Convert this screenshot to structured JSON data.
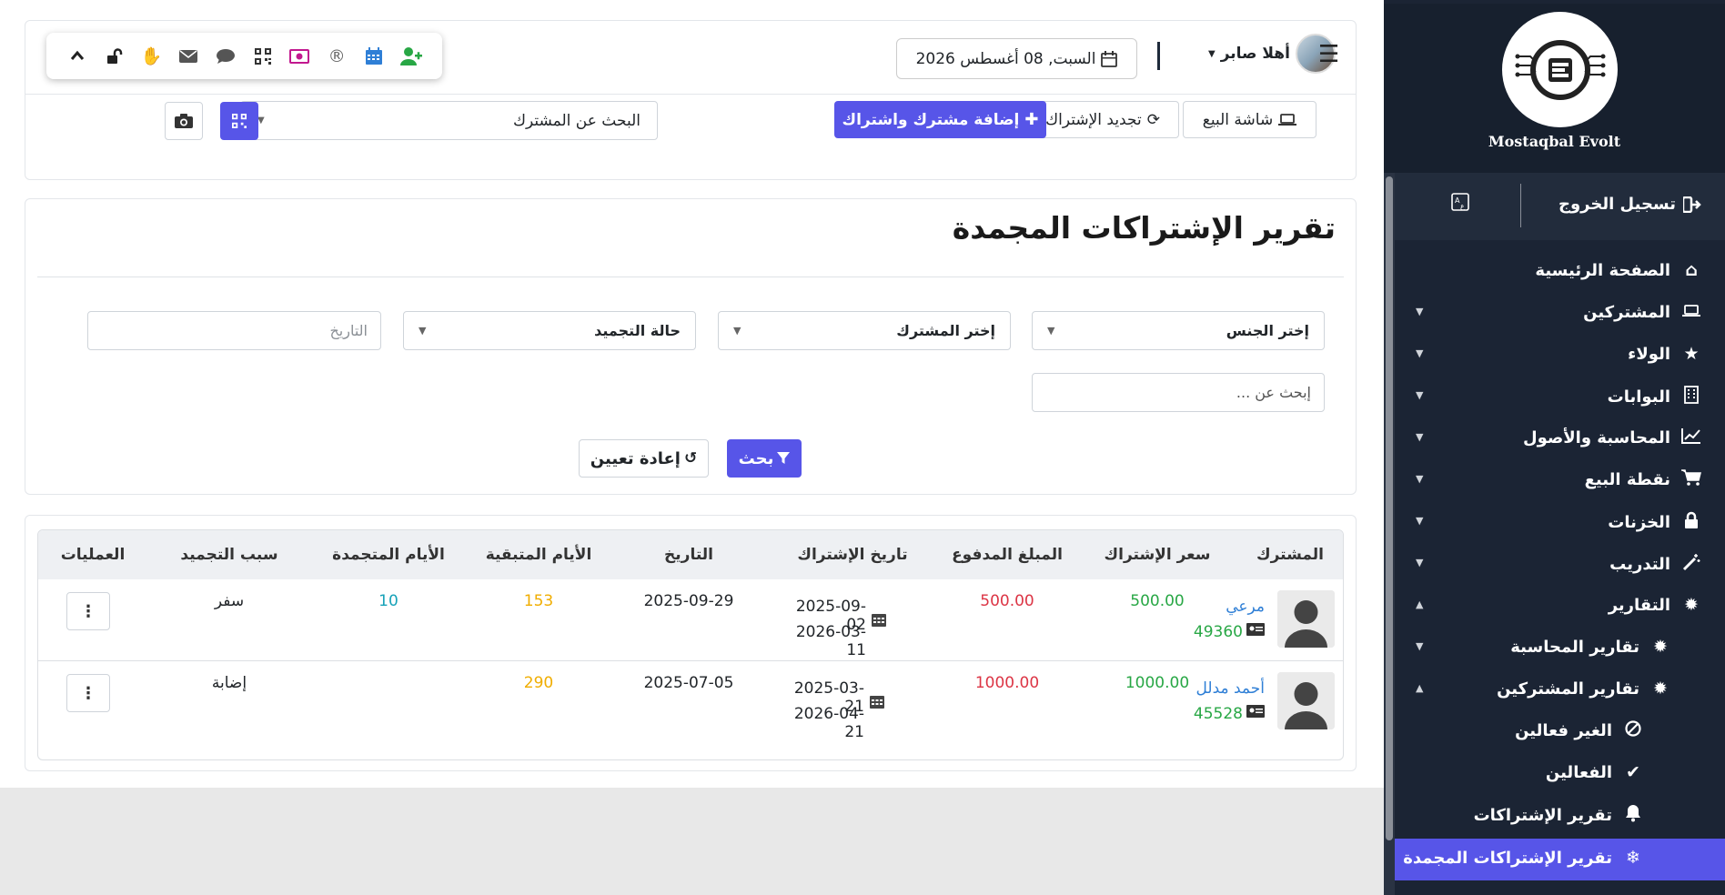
{
  "toolbar": {
    "icons": [
      "user-plus-icon",
      "calendar-icon",
      "registered-icon",
      "money-icon",
      "qrcode-icon",
      "comment-icon",
      "envelope-icon",
      "hand-icon",
      "unlock-icon",
      "chevron-up-icon"
    ],
    "colors": {
      "user_plus": "#28a745",
      "calendar": "#2f7fd6",
      "money": "#c2188f",
      "hand": "#1b8fd6"
    }
  },
  "header": {
    "date": "السبت, 08 أغسطس 2026",
    "greeting": "أهلا صابر",
    "sale_screen_label": "شاشة البيع",
    "renew_label": "تجديد الإشتراك",
    "add_label": "إضافة مشترك واشتراك",
    "subscriber_search_placeholder": "البحث عن المشترك"
  },
  "report": {
    "title": "تقرير الإشتراكات المجمدة",
    "filters": {
      "gender": "إختر الجنس",
      "subscriber": "إختر المشترك",
      "freeze_status": "حالة التجميد",
      "date_placeholder": "التاريخ",
      "search_placeholder": "إبحث عن ..."
    },
    "search_label": "بحث",
    "reset_label": "إعادة تعيين"
  },
  "table": {
    "headers": {
      "subscriber": "المشترك",
      "price": "سعر الإشتراك",
      "paid": "المبلغ المدفوع",
      "sub_date": "تاريخ الإشتراك",
      "date": "التاريخ",
      "remaining": "الأيام المتبقية",
      "frozen": "الأيام المتجمدة",
      "reason": "سبب التجميد",
      "ops": "العمليات"
    },
    "rows": [
      {
        "name": "مرعي",
        "id": "49360",
        "price": "500.00",
        "paid": "500.00",
        "start": "2025-09-02",
        "end": "2026-03-11",
        "date": "2025-09-29",
        "remaining": "153",
        "frozen": "10",
        "reason": "سفر"
      },
      {
        "name": "أحمد مدلل",
        "id": "45528",
        "price": "1000.00",
        "paid": "1000.00",
        "start": "2025-03-21",
        "end": "2026-04-21",
        "date": "2025-07-05",
        "remaining": "290",
        "frozen": "",
        "reason": "إضابة"
      }
    ],
    "colors": {
      "price": "#28a745",
      "paid": "#dc3545",
      "remaining": "#f0ad00",
      "frozen": "#17a2b8",
      "name": "#2f7fd6",
      "id": "#28a745"
    }
  },
  "sidebar": {
    "brand": "Mostaqbal Evolt",
    "logout_label": "تسجيل الخروج",
    "items": [
      {
        "label": "الصفحة الرئيسية",
        "icon": "home-icon"
      },
      {
        "label": "المشتركين",
        "icon": "laptop-icon"
      },
      {
        "label": "الولاء",
        "icon": "star-icon"
      },
      {
        "label": "البوابات",
        "icon": "building-icon"
      },
      {
        "label": "المحاسبة والأصول",
        "icon": "chart-line-icon"
      },
      {
        "label": "نقطة البيع",
        "icon": "cart-icon"
      },
      {
        "label": "الخزنات",
        "icon": "lock-icon"
      },
      {
        "label": "التدريب",
        "icon": "magic-icon"
      },
      {
        "label": "التقارير",
        "icon": "bug-icon"
      },
      {
        "label": "تقارير المحاسبة",
        "icon": "bug-icon"
      },
      {
        "label": "تقارير المشتركين",
        "icon": "bug-icon"
      },
      {
        "label": "الغير فعالين",
        "icon": "ban-icon"
      },
      {
        "label": "الفعالين",
        "icon": "check-icon"
      },
      {
        "label": "تقرير الإشتراكات",
        "icon": "bell-icon"
      },
      {
        "label": "تقرير الإشتراكات المجمدة",
        "icon": "snowflake-icon"
      }
    ],
    "accent": "#5755e8"
  }
}
